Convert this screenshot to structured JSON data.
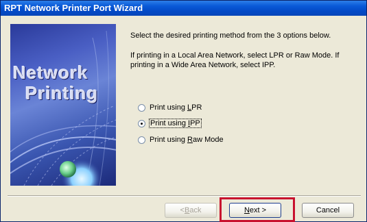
{
  "window": {
    "title": "RPT Network Printer Port Wizard"
  },
  "banner": {
    "line1": "Network",
    "line2": "Printing"
  },
  "instructions": {
    "line1": "Select the desired printing method from the 3 options below.",
    "line2": "If printing in a Local Area Network, select LPR or Raw Mode. If printing in a Wide Area Network, select IPP."
  },
  "options": [
    {
      "label_prefix": "Print using ",
      "label_access": "L",
      "label_suffix": "PR",
      "checked": false
    },
    {
      "label_prefix": "Print using ",
      "label_access": "I",
      "label_suffix": "PP",
      "checked": true
    },
    {
      "label_prefix": "Print using ",
      "label_access": "R",
      "label_suffix": "aw Mode",
      "checked": false
    }
  ],
  "buttons": {
    "back_prefix": "< ",
    "back_access": "B",
    "back_suffix": "ack",
    "next_access": "N",
    "next_suffix": "ext >",
    "cancel": "Cancel"
  },
  "colors": {
    "title_bar": "#0a5ad8",
    "highlight": "#c8102e",
    "dialog_bg": "#ece9d8"
  }
}
